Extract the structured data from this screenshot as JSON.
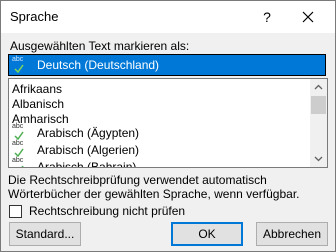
{
  "window": {
    "title": "Sprache",
    "help_glyph": "?"
  },
  "dialog": {
    "mark_label": "Ausgewählten Text markieren als:",
    "selected_language": "Deutsch (Deutschland)",
    "spell_icon_text": "abc",
    "languages": [
      {
        "label": "Afrikaans",
        "spellcheck": false
      },
      {
        "label": "Albanisch",
        "spellcheck": false
      },
      {
        "label": "Amharisch",
        "spellcheck": false
      },
      {
        "label": "Arabisch (Ägypten)",
        "spellcheck": true
      },
      {
        "label": "Arabisch (Algerien)",
        "spellcheck": true
      },
      {
        "label": "Arabisch (Bahrain)",
        "spellcheck": true
      }
    ],
    "description": "Die Rechtschreibprüfung verwendet automatisch Wörterbücher der gewählten Sprache, wenn verfügbar.",
    "no_spellcheck_label": "Rechtschreibung nicht prüfen",
    "no_spellcheck_checked": false,
    "buttons": {
      "standard": "Standard...",
      "ok": "OK",
      "cancel": "Abbrechen"
    }
  }
}
